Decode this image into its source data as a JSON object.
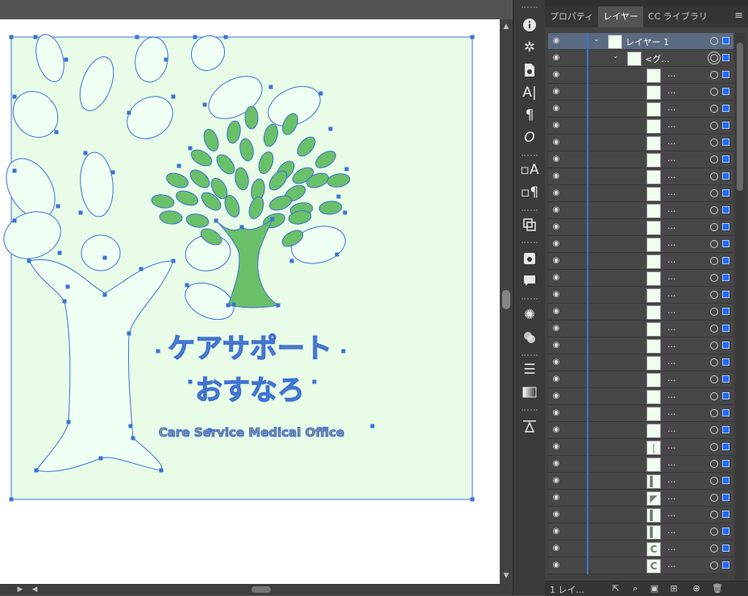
{
  "canvas": {
    "logo_text": {
      "title_jp": "ケアサポート",
      "subtitle_jp": "おすなろ",
      "tagline": "Care Service Medical Office"
    },
    "colors": {
      "accent": "#3b72d6",
      "leaf": "#6abf69",
      "page_fill": "#e8fce8"
    }
  },
  "toolstrip": {
    "icons": [
      "info-icon",
      "gear-icon",
      "document-info-icon",
      "character-icon",
      "paragraph-icon",
      "opentype-icon",
      "character-style-icon",
      "paragraph-style-icon",
      "pathfinder-icon",
      "links-icon",
      "comment-icon",
      "appearance-icon",
      "transparency-icon",
      "stroke-icon",
      "gradient-icon",
      "align-icon"
    ]
  },
  "panel": {
    "tabs": [
      {
        "label": "プロパティ",
        "active": false
      },
      {
        "label": "レイヤー",
        "active": true
      },
      {
        "label": "CC ライブラリ",
        "active": false
      }
    ],
    "menu_icon": "hamburger-icon",
    "layer_row": {
      "label": "レイヤー 1"
    },
    "group_row": {
      "label": "<グ..."
    },
    "item_ellipsis": "...",
    "item_count": 30,
    "footer": {
      "count_label": "1 レイ..."
    }
  }
}
